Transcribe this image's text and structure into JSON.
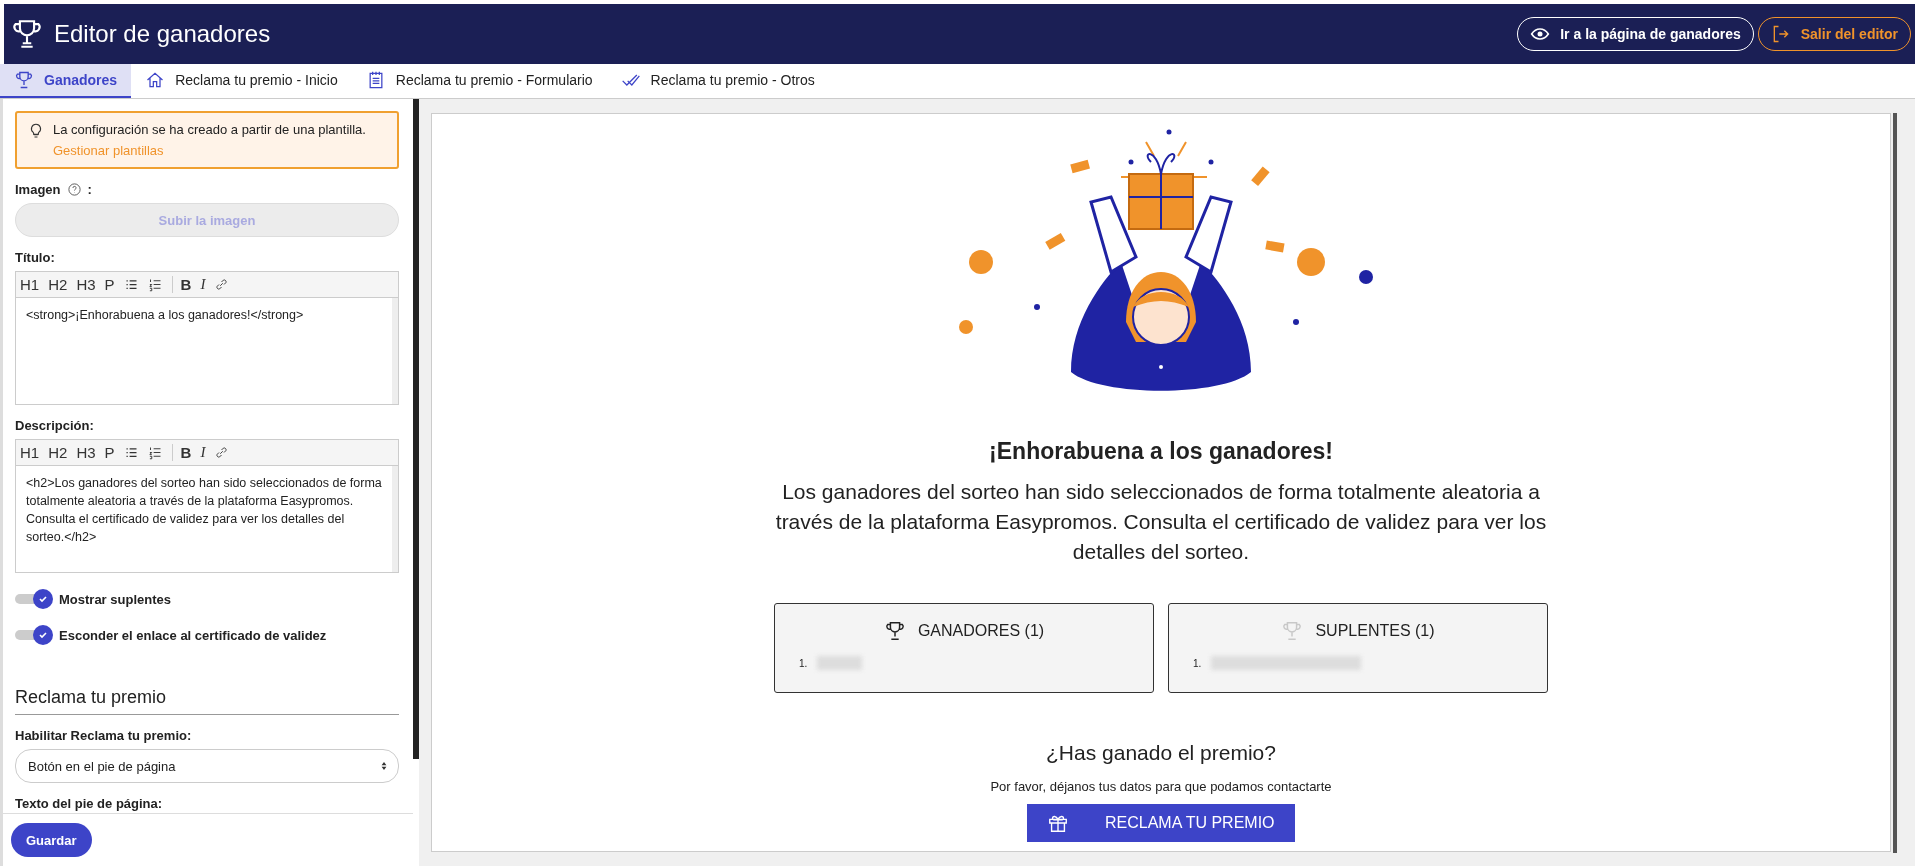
{
  "header": {
    "title": "Editor de ganadores",
    "buttons": [
      {
        "kind": "view",
        "label": "Ir a la página de ganadores"
      },
      {
        "kind": "exit",
        "label": "Salir del editor"
      }
    ]
  },
  "tabs": [
    {
      "kind": "trophy",
      "label": "Ganadores",
      "selected": true
    },
    {
      "kind": "home",
      "label": "Reclama tu premio - Inicio",
      "selected": false
    },
    {
      "kind": "form",
      "label": "Reclama tu premio - Formulario",
      "selected": false
    },
    {
      "kind": "check",
      "label": "Reclama tu premio - Otros",
      "selected": false
    }
  ],
  "sidebar": {
    "notice": {
      "text": "La configuración se ha creado a partir de una plantilla.",
      "link": "Gestionar plantillas"
    },
    "image": {
      "label": "Imagen",
      "colon": ":",
      "button": "Subir la imagen"
    },
    "editors": [
      {
        "label": "Título:",
        "value": "<strong>¡Enhorabuena a los ganadores!</strong>",
        "toolbar": [
          {
            "kind": "text",
            "label": "H1"
          },
          {
            "kind": "text",
            "label": "H2"
          },
          {
            "kind": "text",
            "label": "H3"
          },
          {
            "kind": "text",
            "label": "P"
          },
          {
            "kind": "bullet-list"
          },
          {
            "kind": "numbered-list"
          },
          {
            "kind": "bold",
            "label": "B"
          },
          {
            "kind": "italic",
            "label": "I"
          },
          {
            "kind": "link"
          }
        ]
      },
      {
        "label": "Descripción:",
        "value": "<h2>Los ganadores del sorteo han sido seleccionados de forma totalmente aleatoria a través de la plataforma Easypromos. Consulta el certificado de validez para ver los detalles del sorteo.</h2>",
        "toolbar": [
          {
            "kind": "text",
            "label": "H1"
          },
          {
            "kind": "text",
            "label": "H2"
          },
          {
            "kind": "text",
            "label": "H3"
          },
          {
            "kind": "text",
            "label": "P"
          },
          {
            "kind": "bullet-list"
          },
          {
            "kind": "numbered-list"
          },
          {
            "kind": "bold",
            "label": "B"
          },
          {
            "kind": "italic",
            "label": "I"
          },
          {
            "kind": "link"
          }
        ]
      }
    ],
    "toggles": [
      {
        "label": "Mostrar suplentes",
        "on": true
      },
      {
        "label": "Esconder el enlace al certificado de validez",
        "on": true
      }
    ],
    "section_title": "Reclama tu premio",
    "enable_label": "Habilitar Reclama tu premio:",
    "enable_value": "Botón en el pie de página",
    "footer_label": "Texto del pie de página:",
    "save": "Guardar"
  },
  "preview": {
    "title": "¡Enhorabuena a los ganadores!",
    "description": "Los ganadores del sorteo han sido seleccionados de forma totalmente aleatoria a través de la plataforma Easypromos. Consulta el certificado de validez para ver los detalles del sorteo.",
    "lists": [
      {
        "kind": "winners",
        "title": "GANADORES (1)",
        "items": [
          {
            "number": "1."
          }
        ]
      },
      {
        "kind": "substitutes",
        "title": "SUPLENTES (1)",
        "items": [
          {
            "number": "1."
          }
        ]
      }
    ],
    "claim_title": "¿Has ganado el premio?",
    "claim_text": "Por favor, déjanos tus datos para que podamos contactarte",
    "claim_button": "RECLAMA TU PREMIO"
  }
}
